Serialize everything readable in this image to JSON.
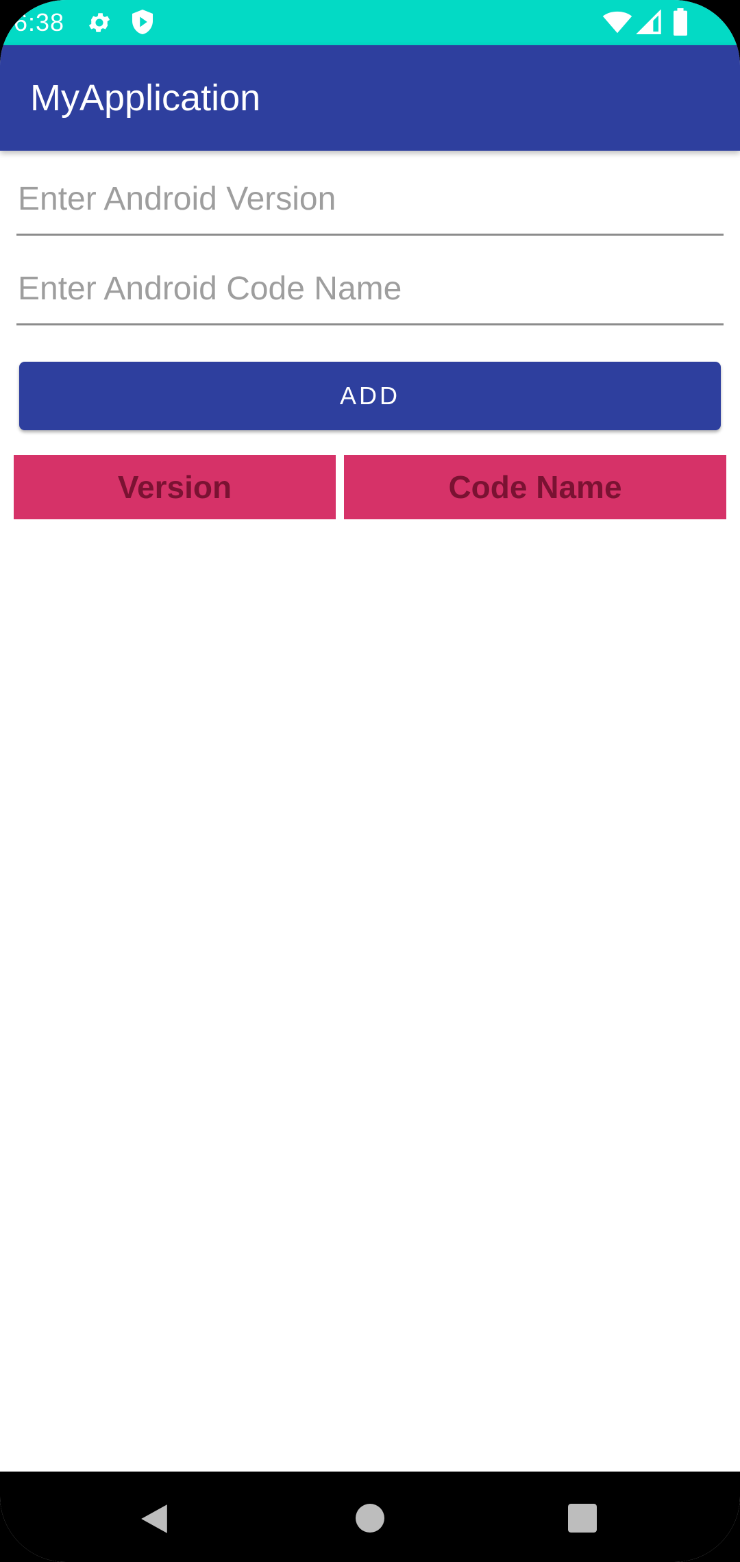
{
  "status_bar": {
    "time": "6:38",
    "color": "#03dac5",
    "icons": [
      "gear-icon",
      "shield-icon",
      "wifi-icon",
      "signal-icon",
      "battery-icon"
    ]
  },
  "app_bar": {
    "title": "MyApplication",
    "color": "#2e3f9e"
  },
  "form": {
    "version_input": {
      "value": "",
      "placeholder": "Enter Android Version"
    },
    "codename_input": {
      "value": "",
      "placeholder": "Enter Android Code Name"
    },
    "add_button_label": "ADD"
  },
  "table": {
    "header_color": "#d63268",
    "columns": [
      "Version",
      "Code Name"
    ],
    "rows": []
  },
  "nav_bar": {
    "buttons": [
      "back-icon",
      "home-icon",
      "recents-icon"
    ]
  }
}
